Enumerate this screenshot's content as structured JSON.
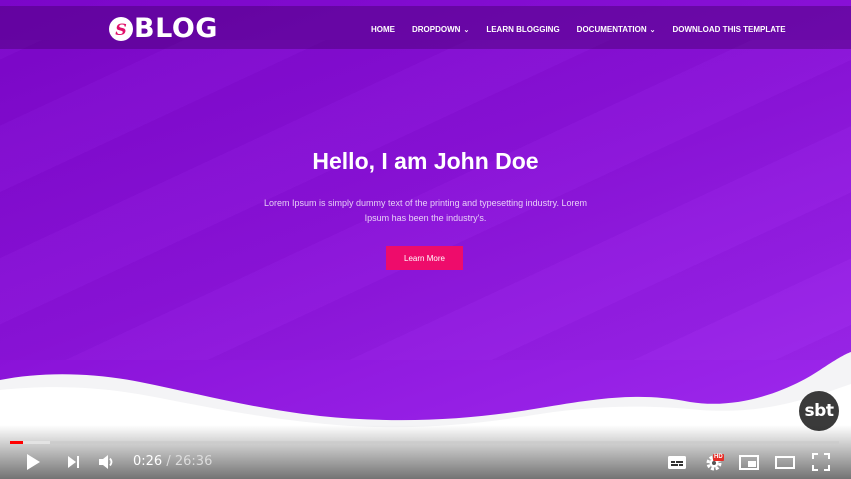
{
  "site": {
    "logo_letter": "S",
    "logo_text": "BLOG",
    "nav": [
      {
        "label": "HOME",
        "has_caret": false
      },
      {
        "label": "DROPDOWN",
        "has_caret": true
      },
      {
        "label": "LEARN BLOGGING",
        "has_caret": false
      },
      {
        "label": "DOCUMENTATION",
        "has_caret": true
      },
      {
        "label": "DOWNLOAD THIS TEMPLATE",
        "has_caret": false
      }
    ],
    "hero_title": "Hello, I am John Doe",
    "hero_text": "Lorem Ipsum is simply dummy text of the printing and typesetting industry. Lorem Ipsum has been the industry's.",
    "cta_label": "Learn More",
    "colors": {
      "primary": "#8a12d8",
      "accent": "#ee0c6b"
    }
  },
  "channel_watermark": "sbt",
  "player": {
    "current_time": "0:26",
    "separator": "/",
    "duration": "26:36",
    "played_fraction": 0.016,
    "buffered_fraction": 0.048,
    "quality_badge": "HD",
    "icons": [
      "play-icon",
      "next-icon",
      "volume-icon",
      "subtitles-icon",
      "settings-icon",
      "miniplayer-icon",
      "theater-icon",
      "fullscreen-icon"
    ]
  }
}
